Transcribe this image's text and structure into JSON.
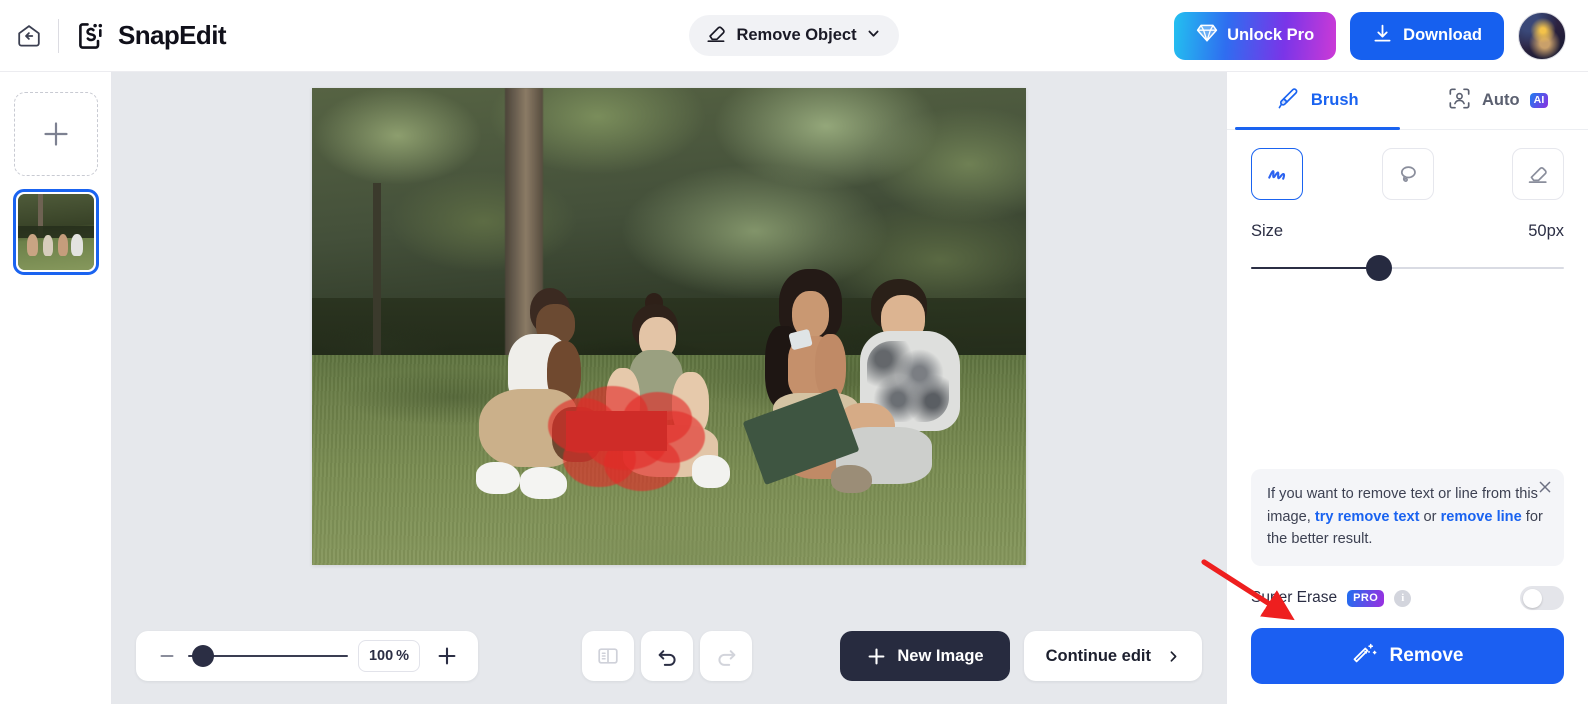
{
  "header": {
    "back_icon": "back-arrow-home-icon",
    "brand_name": "SnapEdit",
    "mode_label": "Remove Object",
    "mode_icon": "eraser-icon",
    "mode_caret_icon": "chevron-down-icon",
    "unlock_pro_label": "Unlock Pro",
    "unlock_pro_icon": "diamond-icon",
    "download_label": "Download",
    "download_icon": "download-icon",
    "avatar_name": "user-avatar"
  },
  "rail": {
    "add_icon": "plus-icon",
    "add_label": "",
    "thumbnails": [
      {
        "name": "park-friends-photo",
        "selected": true
      }
    ]
  },
  "canvas": {
    "image_description": "Four young people sitting on grass in a park, looking at a laptop",
    "mask_color": "#e22a26",
    "mask_label": "brush-mask-selection"
  },
  "bottombar": {
    "zoom_out_icon": "minus-icon",
    "zoom_in_icon": "plus-icon",
    "zoom_value": "100",
    "zoom_unit": "%",
    "zoom_slider_percent": 10,
    "compare_icon": "compare-split-icon",
    "undo_icon": "undo-icon",
    "redo_icon": "redo-icon",
    "new_image_label": "New Image",
    "new_image_icon": "plus-icon",
    "continue_edit_label": "Continue edit",
    "continue_edit_icon": "chevron-right-icon"
  },
  "panel": {
    "tabs": [
      {
        "label": "Brush",
        "icon": "paintbrush-icon",
        "active": true,
        "badge": ""
      },
      {
        "label": "Auto",
        "icon": "face-detect-icon",
        "active": false,
        "badge": "AI"
      }
    ],
    "tools": [
      {
        "name": "brush-tool",
        "icon": "scribble-icon",
        "active": true
      },
      {
        "name": "lasso-tool",
        "icon": "lasso-icon",
        "active": false
      },
      {
        "name": "eraser-tool",
        "icon": "eraser-icon",
        "active": false
      }
    ],
    "size_label": "Size",
    "size_value": "50px",
    "size_slider_percent": 41,
    "tip": {
      "text_before": "If you want to remove text or line from this image, ",
      "link1": "try remove text",
      "text_mid": " or ",
      "link2": "remove line",
      "text_after": " for the better result.",
      "close_icon": "close-icon"
    },
    "super_erase": {
      "label": "Super Erase",
      "badge": "PRO",
      "info_icon": "info-icon",
      "info_glyph": "i",
      "toggle_on": false
    },
    "remove_button": {
      "label": "Remove",
      "icon": "magic-wand-icon"
    }
  },
  "annotation": {
    "arrow": "red-pointer-arrow",
    "points_to": "remove-button"
  },
  "colors": {
    "accent_blue": "#1a63f0",
    "dark_navy": "#272b3f",
    "mask_red": "#e22a26",
    "annotation_red": "#ee1f1f",
    "canvas_bg": "#e6e8ec"
  }
}
